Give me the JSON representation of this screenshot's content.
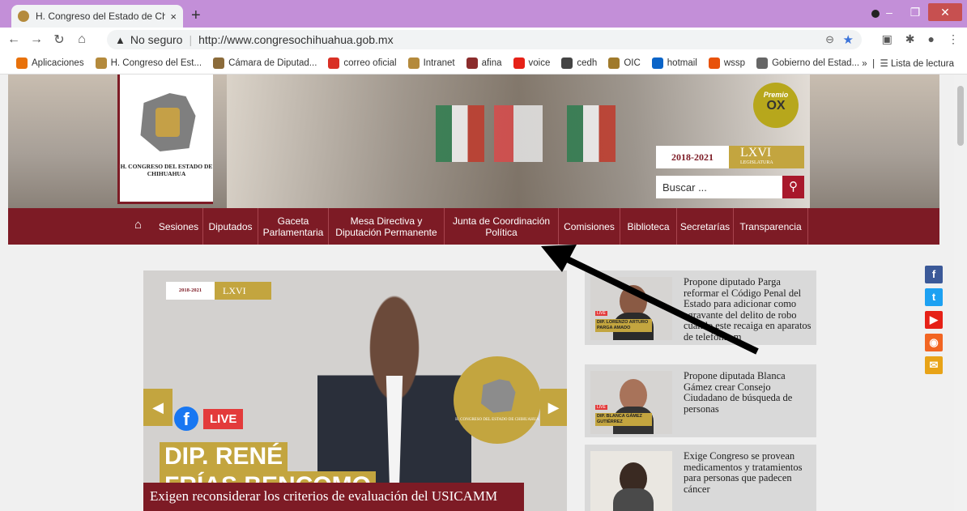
{
  "browser": {
    "tab_title": "H. Congreso del Estado de Chihu",
    "tab_close": "×",
    "new_tab": "+",
    "security_label": "No seguro",
    "url": "http://www.congresochihuahua.gob.mx",
    "bookmarks": [
      {
        "label": "Aplicaciones",
        "icon": "apps-grid-icon",
        "color": "#e8710a"
      },
      {
        "label": "H. Congreso del Est...",
        "icon": "congreso-favicon",
        "color": "#b48a3c"
      },
      {
        "label": "Cámara de Diputad...",
        "icon": "camara-favicon",
        "color": "#8b6b3a"
      },
      {
        "label": "correo oficial",
        "icon": "x-icon",
        "color": "#d93025"
      },
      {
        "label": "Intranet",
        "icon": "congreso-favicon",
        "color": "#b48a3c"
      },
      {
        "label": "afina",
        "icon": "afina-icon",
        "color": "#8b2c2c"
      },
      {
        "label": "voice",
        "icon": "youtube-icon",
        "color": "#e62117"
      },
      {
        "label": "cedh",
        "icon": "cedh-icon",
        "color": "#444444"
      },
      {
        "label": "OIC",
        "icon": "oic-icon",
        "color": "#a07a2b"
      },
      {
        "label": "hotmail",
        "icon": "outlook-icon",
        "color": "#0a64c8"
      },
      {
        "label": "wssp",
        "icon": "alert-icon",
        "color": "#e8520a"
      },
      {
        "label": "Gobierno del Estad...",
        "icon": "shield-icon",
        "color": "#666666"
      }
    ],
    "bookmarks_more": "»",
    "reading_list": "Lista de lectura"
  },
  "site": {
    "logo_text": "H. CONGRESO DEL ESTADO DE CHIHUAHUA",
    "premio_label": "Premio",
    "premio_value": "OX",
    "legislature_years": "2018-2021",
    "legislature_number": "LXVI",
    "legislature_word": "LEGISLATURA",
    "search_placeholder": "Buscar ...",
    "nav": [
      "Sesiones",
      "Diputados",
      "Gaceta Parlamentaria",
      "Mesa Directiva y Diputación Permanente",
      "Junta de Coordinación Política",
      "Comisiones",
      "Biblioteca",
      "Secretarías",
      "Transparencia"
    ]
  },
  "carousel": {
    "badge_years": "2018-2021",
    "badge_number": "LXVI",
    "live_label": "LIVE",
    "name_line1": "DIP. RENÉ",
    "name_line2": "FRÍAS BENCOMO",
    "seal_text": "H. CONGRESO DEL ESTADO DE CHIHUAHUA",
    "caption": "Exigen reconsiderar los criterios de evaluación del USICAMM"
  },
  "news": [
    {
      "text": "Propone diputado Parga reformar el Código Penal del Estado para adicionar como agravante del delito de robo cuando este recaiga en aparatos de telefonía m",
      "thumb_label": "DIP. LORENZO ARTURO PARGA AMADO"
    },
    {
      "text": "Propone diputada Blanca Gámez crear Consejo Ciudadano de búsqueda de personas",
      "thumb_label": "DIP. BLANCA GÁMEZ GUTIÉRREZ"
    },
    {
      "text": "Exige Congreso se provean medicamentos y tratamientos para personas que padecen cáncer",
      "thumb_label": ""
    }
  ],
  "social": [
    {
      "name": "facebook-icon",
      "glyph": "f",
      "color": "#3b5998"
    },
    {
      "name": "twitter-icon",
      "glyph": "t",
      "color": "#1da1f2"
    },
    {
      "name": "youtube-icon",
      "glyph": "▶",
      "color": "#e62117"
    },
    {
      "name": "rss-icon",
      "glyph": "◉",
      "color": "#f26522"
    },
    {
      "name": "email-icon",
      "glyph": "✉",
      "color": "#e8a317"
    }
  ]
}
